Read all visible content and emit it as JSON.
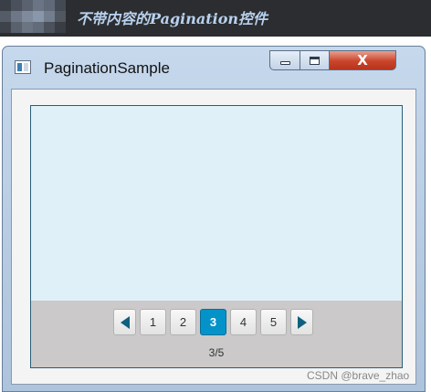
{
  "banner": {
    "title": "不带内容的Pagination控件",
    "bg_color": "#2b2d30",
    "title_color": "#b9d1ee"
  },
  "window": {
    "title": "PaginationSample",
    "icon": "app-window-icon",
    "controls": {
      "minimize_icon": "minimize-icon",
      "maximize_icon": "maximize-icon",
      "close_icon": "close-icon",
      "close_glyph": "X"
    }
  },
  "pagination": {
    "content_color": "#dff0f8",
    "bar_color": "#cbc9c9",
    "prev_icon": "triangle-left-icon",
    "next_icon": "triangle-right-icon",
    "pages": [
      "1",
      "2",
      "3",
      "4",
      "5"
    ],
    "current_page": "3",
    "accent_color": "#0493c9",
    "page_info": "3/5"
  },
  "watermark": "CSDN @brave_zhao"
}
